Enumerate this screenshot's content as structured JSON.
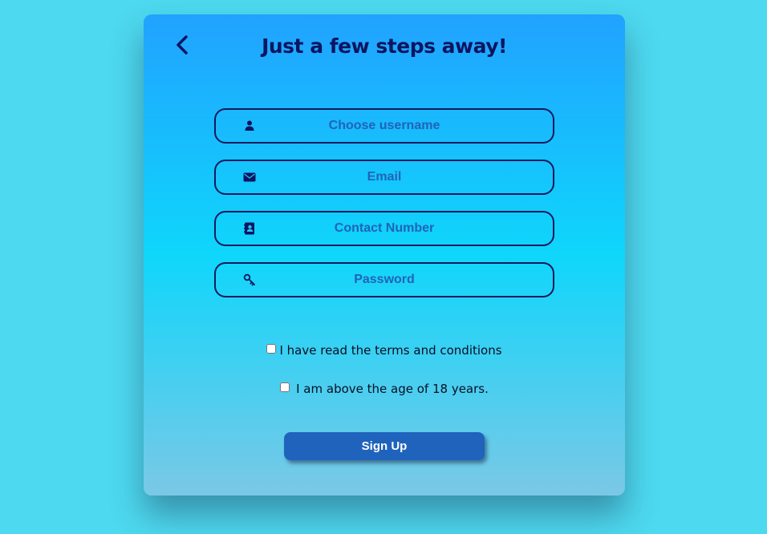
{
  "header": {
    "back_icon": "chevron-left-icon",
    "title": "Just a few steps away!"
  },
  "form": {
    "fields": [
      {
        "icon": "user-icon",
        "placeholder": "Choose username",
        "value": ""
      },
      {
        "icon": "envelope-icon",
        "placeholder": "Email",
        "value": ""
      },
      {
        "icon": "contact-book-icon",
        "placeholder": "Contact Number",
        "value": ""
      },
      {
        "icon": "key-icon",
        "placeholder": "Password",
        "value": ""
      }
    ],
    "checkboxes": [
      {
        "label": "I have read the terms and conditions",
        "checked": false
      },
      {
        "label": "I am above the age of 18 years.",
        "checked": false
      }
    ],
    "submit_label": "Sign Up"
  },
  "colors": {
    "page_background": "#4dd9ef",
    "card_gradient_top": "#21a2ff",
    "card_gradient_mid": "#0fd6fb",
    "card_gradient_bottom": "#7bc8e6",
    "ink": "#0c1561",
    "placeholder": "#2163b8",
    "button": "#1f63bd"
  }
}
